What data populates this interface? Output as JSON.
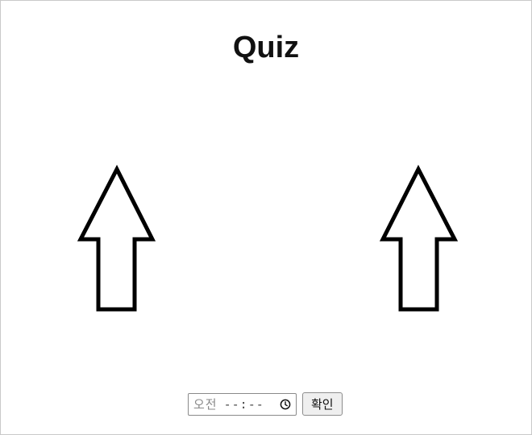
{
  "page": {
    "title": "Quiz"
  },
  "arrows": {
    "left_icon": "up-arrow-icon",
    "right_icon": "up-arrow-icon"
  },
  "time_input": {
    "ampm": "오전",
    "value": "--:--",
    "icon": "clock-icon"
  },
  "confirm_button": {
    "label": "확인"
  },
  "colors": {
    "background": "#ffffff",
    "border": "#c9c9c9",
    "text": "#111111",
    "arrow_stroke": "#000000"
  }
}
